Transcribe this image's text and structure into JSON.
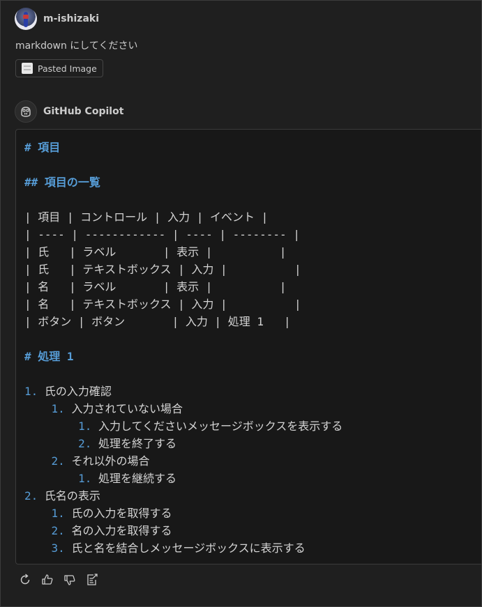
{
  "user": {
    "name": "m-ishizaki",
    "message": "markdown にしてください",
    "attachment_label": "Pasted Image"
  },
  "assistant": {
    "name": "GitHub Copilot",
    "lines": [
      {
        "pre": "",
        "mark": "# ",
        "text": "項目",
        "kind": "heading"
      },
      {
        "pre": "",
        "mark": "",
        "text": "",
        "kind": "blank"
      },
      {
        "pre": "",
        "mark": "## ",
        "text": "項目の一覧",
        "kind": "heading"
      },
      {
        "pre": "",
        "mark": "",
        "text": "",
        "kind": "blank"
      },
      {
        "pre": "",
        "mark": "",
        "text": "| 項目 | コントロール | 入力 | イベント |",
        "kind": "text"
      },
      {
        "pre": "",
        "mark": "",
        "text": "| ---- | ------------ | ---- | -------- |",
        "kind": "text"
      },
      {
        "pre": "",
        "mark": "",
        "text": "| 氏   | ラベル       | 表示 |          |",
        "kind": "text"
      },
      {
        "pre": "",
        "mark": "",
        "text": "| 氏   | テキストボックス | 入力 |          |",
        "kind": "text"
      },
      {
        "pre": "",
        "mark": "",
        "text": "| 名   | ラベル       | 表示 |          |",
        "kind": "text"
      },
      {
        "pre": "",
        "mark": "",
        "text": "| 名   | テキストボックス | 入力 |          |",
        "kind": "text"
      },
      {
        "pre": "",
        "mark": "",
        "text": "| ボタン | ボタン       | 入力 | 処理 1   |",
        "kind": "text"
      },
      {
        "pre": "",
        "mark": "",
        "text": "",
        "kind": "blank"
      },
      {
        "pre": "",
        "mark": "# ",
        "text": "処理 1",
        "kind": "heading"
      },
      {
        "pre": "",
        "mark": "",
        "text": "",
        "kind": "blank"
      },
      {
        "pre": "",
        "mark": "1. ",
        "text": "氏の入力確認",
        "kind": "list"
      },
      {
        "pre": "    ",
        "mark": "1. ",
        "text": "入力されていない場合",
        "kind": "list"
      },
      {
        "pre": "        ",
        "mark": "1. ",
        "text": "入力してくださいメッセージボックスを表示する",
        "kind": "list"
      },
      {
        "pre": "        ",
        "mark": "2. ",
        "text": "処理を終了する",
        "kind": "list"
      },
      {
        "pre": "    ",
        "mark": "2. ",
        "text": "それ以外の場合",
        "kind": "list"
      },
      {
        "pre": "        ",
        "mark": "1. ",
        "text": "処理を継続する",
        "kind": "list"
      },
      {
        "pre": "",
        "mark": "2. ",
        "text": "氏名の表示",
        "kind": "list"
      },
      {
        "pre": "    ",
        "mark": "1. ",
        "text": "氏の入力を取得する",
        "kind": "list"
      },
      {
        "pre": "    ",
        "mark": "2. ",
        "text": "名の入力を取得する",
        "kind": "list"
      },
      {
        "pre": "    ",
        "mark": "3. ",
        "text": "氏と名を結合しメッセージボックスに表示する",
        "kind": "list"
      }
    ]
  },
  "actions": [
    {
      "name": "retry-icon"
    },
    {
      "name": "thumbs-up-icon"
    },
    {
      "name": "thumbs-down-icon"
    },
    {
      "name": "insert-into-editor-icon"
    }
  ],
  "colors": {
    "background": "#1f1f1f",
    "code_background": "#181818",
    "markdown_accent": "#569cd6",
    "text": "#cccccc"
  }
}
